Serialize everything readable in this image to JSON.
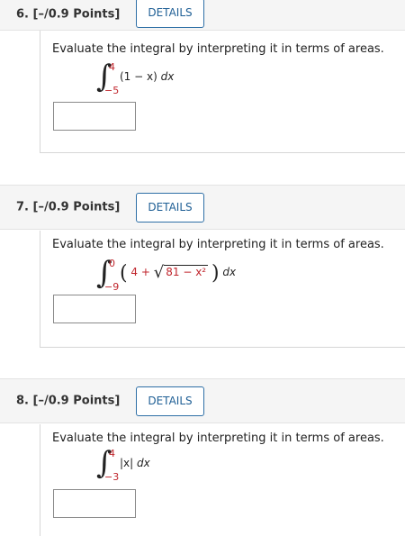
{
  "questions": [
    {
      "title": "6.  [–/0.9 Points]",
      "details_label": "DETAILS",
      "prompt": "Evaluate the integral by interpreting it in terms of areas.",
      "upper": "4",
      "lower": "−5",
      "integrand": "(1 − x)",
      "dx": "dx"
    },
    {
      "title": "7.  [–/0.9 Points]",
      "details_label": "DETAILS",
      "prompt": "Evaluate the integral by interpreting it in terms of areas.",
      "upper": "0",
      "lower": "−9",
      "integrand_lead": "4 +",
      "radicand": "81 − x²",
      "dx": "dx"
    },
    {
      "title": "8.  [–/0.9 Points]",
      "details_label": "DETAILS",
      "prompt": "Evaluate the integral by interpreting it in terms of areas.",
      "upper": "4",
      "lower": "−3",
      "integrand": "|x|",
      "dx": "dx"
    }
  ]
}
